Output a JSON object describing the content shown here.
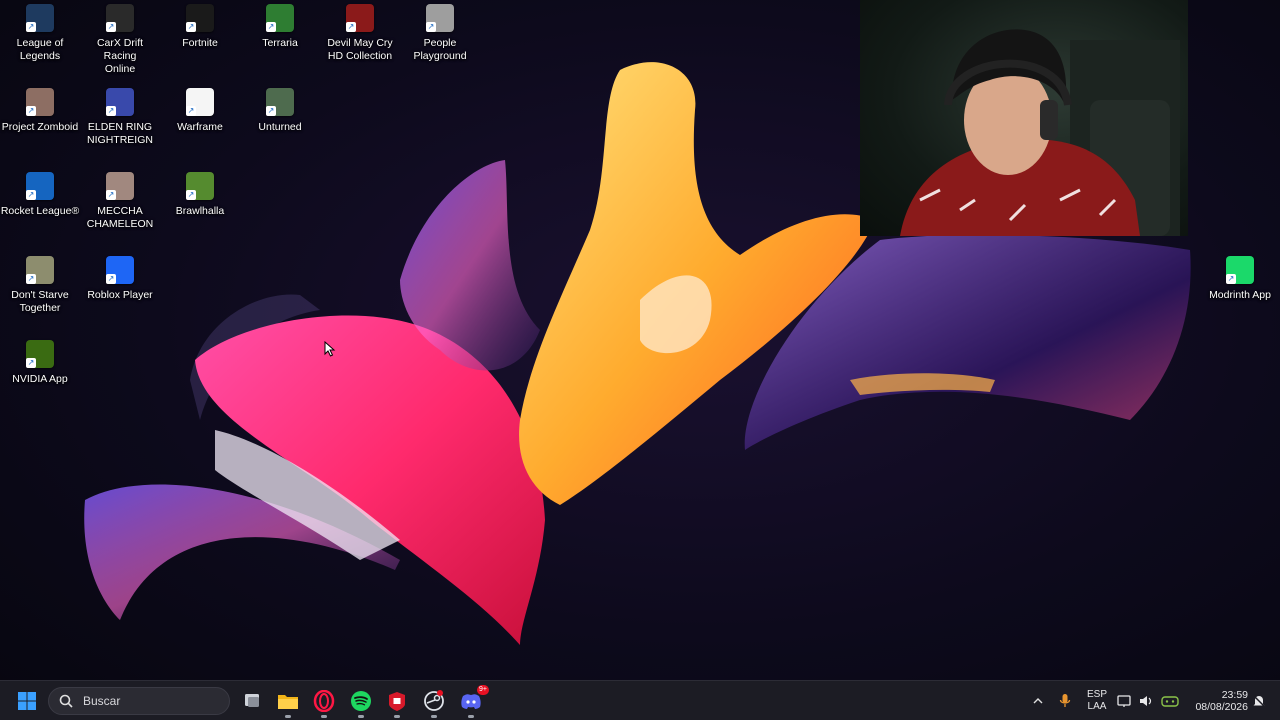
{
  "desktop": {
    "icons": [
      {
        "label": "League of\nLegends",
        "icon": "league-of-legends-icon",
        "color": "#1e3a5f"
      },
      {
        "label": "CarX Drift Racing\nOnline",
        "icon": "carx-drift-racing-icon",
        "color": "#2a2a2a"
      },
      {
        "label": "Fortnite",
        "icon": "fortnite-epic-icon",
        "color": "#1a1a1a"
      },
      {
        "label": "Terraria",
        "icon": "terraria-tree-icon",
        "color": "#2e7d32"
      },
      {
        "label": "Devil May Cry\nHD Collection",
        "icon": "devil-may-cry-icon",
        "color": "#8b1a1a"
      },
      {
        "label": "People\nPlayground",
        "icon": "people-playground-icon",
        "color": "#9e9e9e"
      },
      {
        "label": "Project Zomboid",
        "icon": "project-zomboid-icon",
        "color": "#8d6e63"
      },
      {
        "label": "ELDEN RING\nNIGHTREIGN",
        "icon": "elden-ring-nightreign-icon",
        "color": "#3949ab"
      },
      {
        "label": "Warframe",
        "icon": "warframe-icon",
        "color": "#f5f5f5"
      },
      {
        "label": "Unturned",
        "icon": "unturned-icon",
        "color": "#4e6b4e"
      },
      {
        "label": "Rocket League®",
        "icon": "rocket-league-icon",
        "color": "#1565c0"
      },
      {
        "label": "MECCHA\nCHAMELEON",
        "icon": "meccha-chameleon-icon",
        "color": "#a1887f"
      },
      {
        "label": "Brawlhalla",
        "icon": "brawlhalla-icon",
        "color": "#558b2f"
      },
      {
        "label": "Don't Starve\nTogether",
        "icon": "dont-starve-together-icon",
        "color": "#8d8d6e"
      },
      {
        "label": "Roblox Player",
        "icon": "roblox-icon",
        "color": "#1e66f5"
      },
      {
        "label": "NVIDIA App",
        "icon": "nvidia-icon",
        "color": "#3a6b12"
      },
      {
        "label": "Modrinth App",
        "icon": "modrinth-icon",
        "color": "#1bd96a"
      }
    ]
  },
  "taskbar": {
    "search_placeholder": "Buscar",
    "apps": [
      {
        "name": "start-button",
        "icon": "windows-start-icon"
      },
      {
        "name": "task-view-button",
        "icon": "task-view-icon"
      },
      {
        "name": "file-explorer-button",
        "icon": "folder-icon"
      },
      {
        "name": "opera-gx-button",
        "icon": "opera-gx-icon"
      },
      {
        "name": "spotify-button",
        "icon": "spotify-icon"
      },
      {
        "name": "app-red-button",
        "icon": "red-app-icon"
      },
      {
        "name": "steam-button",
        "icon": "steam-icon"
      },
      {
        "name": "discord-button",
        "icon": "discord-icon"
      }
    ],
    "discord_badge": "9+",
    "tray": {
      "language_top": "ESP",
      "language_bottom": "LAA",
      "time": "23:59",
      "date": "08/08/2026"
    }
  },
  "colors": {
    "taskbar_bg": "#1c1c24",
    "accent_blue": "#0078d4"
  }
}
